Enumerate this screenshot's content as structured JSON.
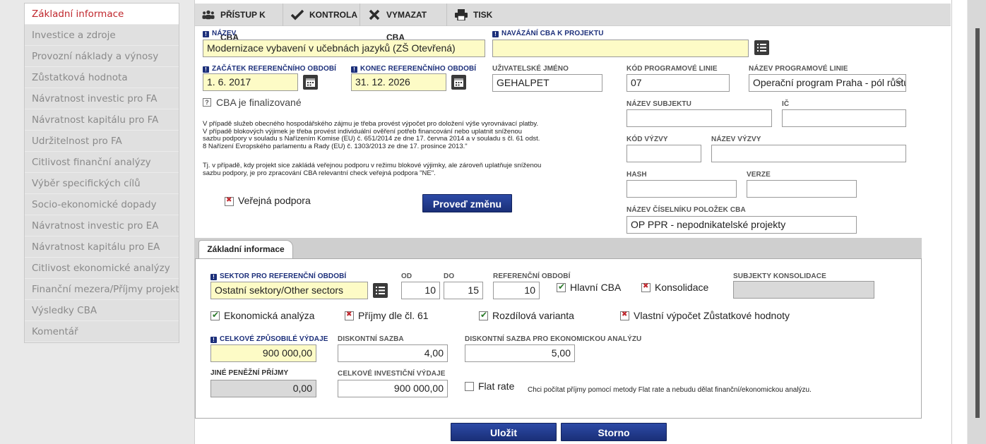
{
  "sidebar": {
    "items": [
      {
        "label": "Základní informace",
        "active": true
      },
      {
        "label": "Investice a zdroje"
      },
      {
        "label": "Provozní náklady a výnosy"
      },
      {
        "label": "Zůstatková hodnota"
      },
      {
        "label": "Návratnost investic pro FA"
      },
      {
        "label": "Návratnost kapitálu pro FA"
      },
      {
        "label": "Udržitelnost pro FA"
      },
      {
        "label": "Citlivost finanční analýzy"
      },
      {
        "label": "Výběr specifických cílů"
      },
      {
        "label": "Socio-ekonomické dopady"
      },
      {
        "label": "Návratnost investic pro EA"
      },
      {
        "label": "Návratnost kapitálu pro EA"
      },
      {
        "label": "Citlivost ekonomické analýzy"
      },
      {
        "label": "Finanční mezera/Příjmy projektu"
      },
      {
        "label": "Výsledky CBA"
      },
      {
        "label": "Komentář"
      }
    ]
  },
  "toolbar": {
    "access": "PŘÍSTUP K CBA",
    "check": "KONTROLA",
    "delete": "VYMAZAT CBA",
    "print": "TISK"
  },
  "form": {
    "nazev_label": "NÁZEV",
    "nazev_value": "Modernizace vybavení v učebnách jazyků (ZŠ Otevřená)",
    "navazani_label": "NAVÁZÁNÍ CBA K PROJEKTU",
    "navazani_value": "",
    "zacatek_label": "ZAČÁTEK REFERENČNÍHO OBDOBÍ",
    "zacatek_value": "1. 6. 2017",
    "konec_label": "KONEC REFERENČNÍHO OBDOBÍ",
    "konec_value": "31. 12. 2026",
    "uzivatel_label": "UŽIVATELSKÉ JMÉNO",
    "uzivatel_value": "GEHALPET",
    "kod_linie_label": "KÓD PROGRAMOVÉ LINIE",
    "kod_linie_value": "07",
    "nazev_linie_label": "NÁZEV PROGRAMOVÉ LINIE",
    "nazev_linie_value": "Operační program Praha - pól růstu",
    "cba_final_label": "CBA je finalizované",
    "nazev_subjektu_label": "NÁZEV SUBJEKTU",
    "ic_label": "IČ",
    "kod_vyzvy_label": "KÓD VÝZVY",
    "nazev_vyzvy_label": "NÁZEV VÝZVY",
    "hash_label": "HASH",
    "verze_label": "VERZE",
    "ciselnik_label": "NÁZEV ČÍSELNÍKU POLOŽEK CBA",
    "ciselnik_value": "OP PPR - nepodnikatelské projekty",
    "info_text_1": "V případě služeb obecného hospodářského zájmu je třeba provést výpočet pro doložení výše vyrovnávací platby. V případě blokových výjimek je třeba provést individuální ověření potřeb financování nebo uplatnit sníženou sazbu podpory v souladu s Nařízením Komise (EU) č. 651/2014 ze dne 17. června 2014 a v souladu s čl. 61 odst. 8 Nařízení Evropského parlamentu a Rady (EU) č. 1303/2013 ze dne 17. prosince 2013.\"",
    "info_text_2": "Tj. v případě, kdy projekt sice zakládá veřejnou podporu v režimu blokové výjimky, ale zároveň uplatňuje sníženou sazbu podpory, je pro zpracování CBA relevantní check veřejná podpora \"NE\".",
    "verejna_podpora_label": "Veřejná podpora",
    "provest_zmenu": "Proveď změnu"
  },
  "tab": {
    "label": "Základní informace"
  },
  "panel": {
    "sektor_label": "SEKTOR PRO REFERENČNÍ OBDOBÍ",
    "sektor_value": "Ostatní sektory/Other sectors",
    "od_label": "OD",
    "od_value": "10",
    "do_label": "DO",
    "do_value": "15",
    "ref_label": "REFERENČNÍ OBDOBÍ",
    "ref_value": "10",
    "hlavni_cba": "Hlavní CBA",
    "konsolidace": "Konsolidace",
    "subjekty_label": "SUBJEKTY KONSOLIDACE",
    "ekonomicka": "Ekonomická analýza",
    "prijmy61": "Příjmy dle čl. 61",
    "rozdilova": "Rozdílová varianta",
    "vlastni": "Vlastní výpočet Zůstatkové hodnoty",
    "celkove_label": "CELKOVÉ ZPŮSOBILÉ VÝDAJE",
    "celkove_value": "900 000,00",
    "diskont_label": "DISKONTNÍ SAZBA",
    "diskont_value": "4,00",
    "diskont_ek_label": "DISKONTNÍ SAZBA PRO EKONOMICKOU ANALÝZU",
    "diskont_ek_value": "5,00",
    "jine_label": "JINÉ PENĚŽNÍ PŘÍJMY",
    "jine_value": "0,00",
    "investicni_label": "CELKOVÉ INVESTIČNÍ VÝDAJE",
    "investicni_value": "900 000,00",
    "flat_rate": "Flat rate",
    "flat_note": "Chci počítat příjmy pomocí metody Flat rate a nebudu dělat finanční/ekonomickou analýzu."
  },
  "buttons": {
    "save": "Uložit",
    "cancel": "Storno"
  }
}
